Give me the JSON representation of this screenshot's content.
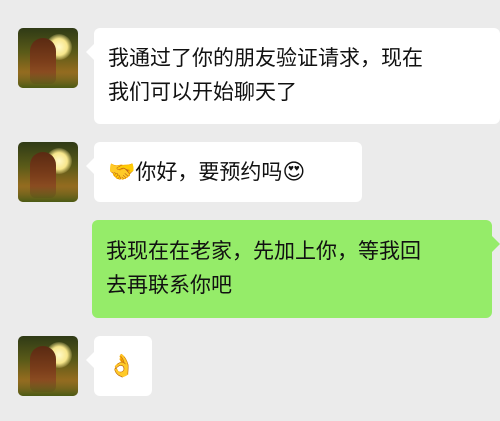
{
  "messages": [
    {
      "side": "left",
      "text_line1": "我通过了你的朋友验证请求，现在",
      "text_line2": "我们可以开始聊天了"
    },
    {
      "side": "left",
      "emoji_before": "🤝",
      "text": "你好，要预约吗",
      "emoji_after": "😍"
    },
    {
      "side": "right",
      "text_line1": "我现在在老家，先加上你，等我回",
      "text_line2": "去再联系你吧"
    },
    {
      "side": "left",
      "emoji": "👌"
    }
  ],
  "colors": {
    "background": "#ebebeb",
    "incoming_bubble": "#ffffff",
    "outgoing_bubble": "#95ec69"
  }
}
